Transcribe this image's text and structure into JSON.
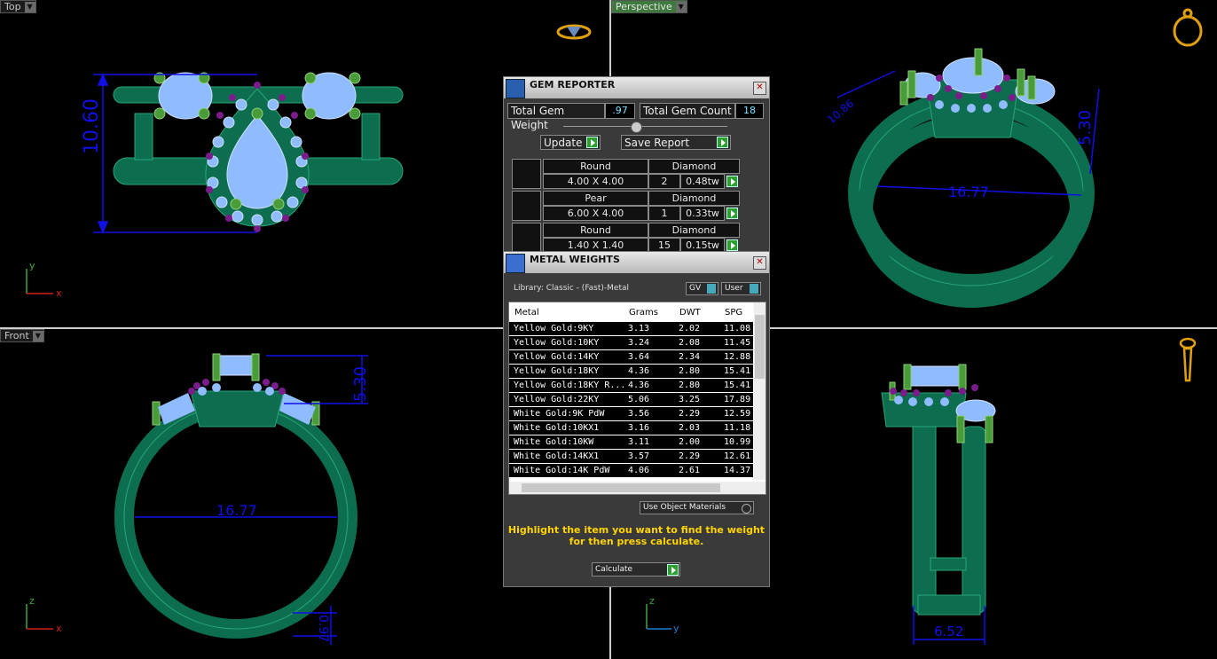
{
  "viewports": {
    "top": {
      "label": "Top",
      "dims": [
        "10.60"
      ]
    },
    "perspective": {
      "label": "Perspective",
      "dims": [
        "10.86",
        "16.77",
        "5.30"
      ]
    },
    "front": {
      "label": "Front",
      "dims": [
        "16.77",
        "5.30",
        "0.97"
      ]
    },
    "right": {
      "dims": [
        "6.52"
      ]
    }
  },
  "axes": {
    "top": [
      "y",
      "x"
    ],
    "front": [
      "z",
      "x"
    ],
    "right": [
      "z",
      "y"
    ]
  },
  "gem_reporter": {
    "title": "GEM REPORTER",
    "total_weight_label": "Total Gem Weight",
    "total_weight": ".97",
    "total_count_label": "Total Gem Count",
    "total_count": "18",
    "update_label": "Update",
    "save_label": "Save Report",
    "gems": [
      {
        "shape": "Round",
        "size": "4.00 X 4.00",
        "type": "Diamond",
        "count": "2",
        "weight": "0.48tw"
      },
      {
        "shape": "Pear",
        "size": "6.00 X 4.00",
        "type": "Diamond",
        "count": "1",
        "weight": "0.33tw"
      },
      {
        "shape": "Round",
        "size": "1.40 X 1.40",
        "type": "Diamond",
        "count": "15",
        "weight": "0.15tw"
      }
    ]
  },
  "metal_weights": {
    "title": "METAL WEIGHTS",
    "library": "Library: Classic - (Fast)-Metal",
    "gv_label": "GV",
    "user_label": "User",
    "columns": [
      "Metal",
      "Grams",
      "DWT",
      "SPG"
    ],
    "rows": [
      [
        "Yellow Gold:9KY",
        "3.13",
        "2.02",
        "11.08"
      ],
      [
        "Yellow Gold:10KY",
        "3.24",
        "2.08",
        "11.45"
      ],
      [
        "Yellow Gold:14KY",
        "3.64",
        "2.34",
        "12.88"
      ],
      [
        "Yellow Gold:18KY",
        "4.36",
        "2.80",
        "15.41"
      ],
      [
        "Yellow Gold:18KY R...",
        "4.36",
        "2.80",
        "15.41"
      ],
      [
        "Yellow Gold:22KY",
        "5.06",
        "3.25",
        "17.89"
      ],
      [
        "White Gold:9K PdW",
        "3.56",
        "2.29",
        "12.59"
      ],
      [
        "White Gold:10KX1",
        "3.16",
        "2.03",
        "11.18"
      ],
      [
        "White Gold:10KW",
        "3.11",
        "2.00",
        "10.99"
      ],
      [
        "White Gold:14KX1",
        "3.57",
        "2.29",
        "12.61"
      ],
      [
        "White Gold:14K PdW",
        "4.06",
        "2.61",
        "14.37"
      ]
    ],
    "use_object_materials": "Use Object Materials",
    "message_line1": "Highlight the item you want to find the weight",
    "message_line2": "for then press calculate.",
    "calculate_label": "Calculate"
  },
  "colors": {
    "metal": "#0c6e4e",
    "gem": "#8fbbff",
    "prong": "#4a9c3a",
    "accent_gem": "#7a1c8a",
    "dimension": "#1010e6"
  }
}
